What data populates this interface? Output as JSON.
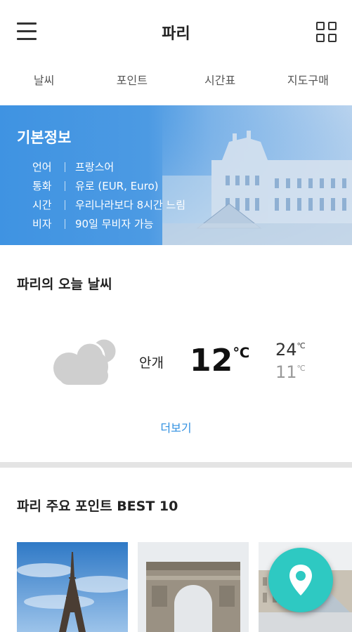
{
  "header": {
    "title": "파리",
    "menu_icon": "hamburger-menu-icon",
    "grid_icon": "grid-icon"
  },
  "tabs": [
    {
      "label": "날씨"
    },
    {
      "label": "포인트"
    },
    {
      "label": "시간표"
    },
    {
      "label": "지도구매"
    }
  ],
  "basic_info": {
    "title": "기본정보",
    "rows": [
      {
        "key": "언어",
        "value": "프랑스어"
      },
      {
        "key": "통화",
        "value": "유로 (EUR, Euro)"
      },
      {
        "key": "시간",
        "value": "우리나라보다 8시간 느림"
      },
      {
        "key": "비자",
        "value": "90일 무비자 가능"
      }
    ]
  },
  "weather": {
    "title": "파리의 오늘 날씨",
    "icon": "cloud-icon",
    "condition": "안개",
    "current": "12",
    "high": "24",
    "low": "11",
    "unit": "℃",
    "more_label": "더보기"
  },
  "points": {
    "title": "파리 주요 포인트 BEST 10",
    "items": [
      {
        "image": "eiffel-tower-photo"
      },
      {
        "image": "arc-de-triomphe-photo"
      },
      {
        "image": "louvre-photo"
      }
    ]
  },
  "fab": {
    "icon": "map-pin-icon"
  },
  "colors": {
    "banner": "#4a98e2",
    "accent": "#2f8fe0",
    "fab": "#2ec9c2"
  }
}
